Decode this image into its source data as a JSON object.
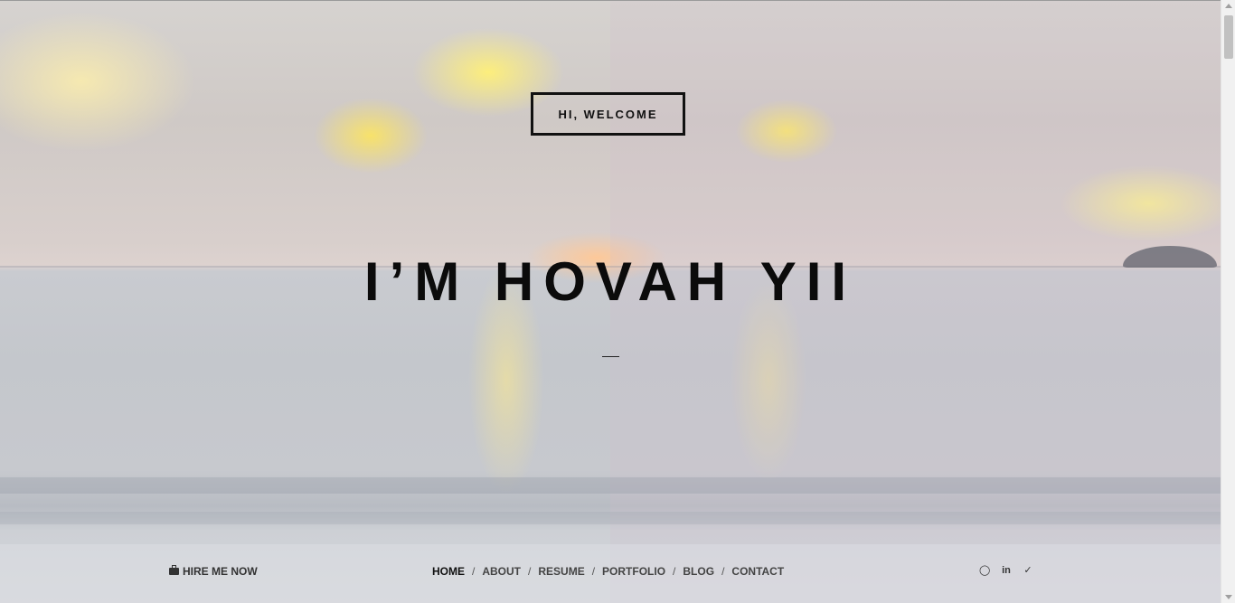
{
  "hero": {
    "welcome_label": "HI, WELCOME",
    "headline": "I’M HOVAH YII"
  },
  "footer": {
    "hire_label": "HIRE ME NOW",
    "nav": [
      {
        "label": "HOME",
        "active": true
      },
      {
        "label": "ABOUT",
        "active": false
      },
      {
        "label": "RESUME",
        "active": false
      },
      {
        "label": "PORTFOLIO",
        "active": false
      },
      {
        "label": "BLOG",
        "active": false
      },
      {
        "label": "CONTACT",
        "active": false
      }
    ],
    "separator": "/",
    "social": [
      {
        "icon": "github-icon",
        "glyph": "◯"
      },
      {
        "icon": "linkedin-icon",
        "glyph": "in"
      },
      {
        "icon": "twitter-icon",
        "glyph": "✓"
      }
    ]
  }
}
